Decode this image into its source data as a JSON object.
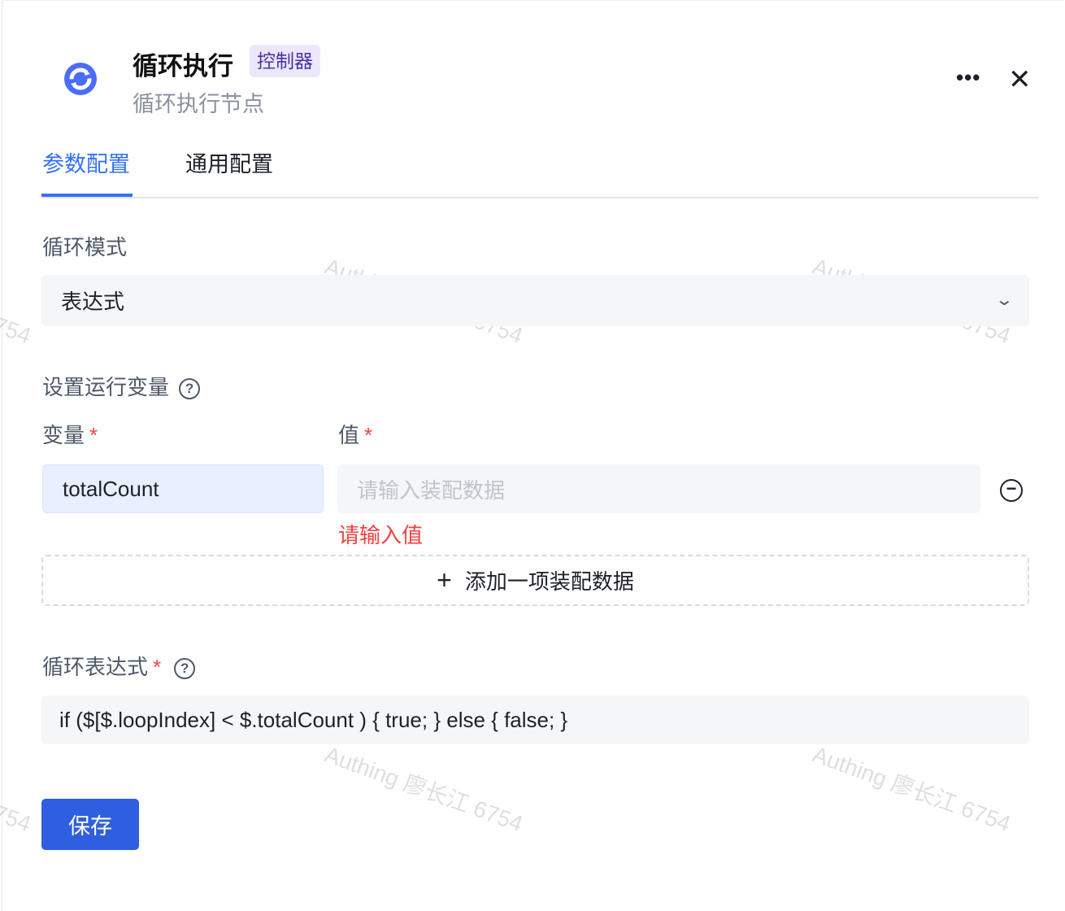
{
  "header": {
    "title": "循环执行",
    "tag": "控制器",
    "subtitle": "循环执行节点",
    "more_icon": "more-icon",
    "close_icon": "close-icon",
    "node_icon": "loop-icon"
  },
  "tabs": [
    {
      "label": "参数配置",
      "active": true
    },
    {
      "label": "通用配置",
      "active": false
    }
  ],
  "loop_mode": {
    "label": "循环模式",
    "value": "表达式"
  },
  "runtime_vars": {
    "label": "设置运行变量",
    "var_label": "变量",
    "value_label": "值",
    "required_mark": "*",
    "rows": [
      {
        "variable": "totalCount",
        "value_placeholder": "请输入装配数据",
        "error": "请输入值"
      }
    ],
    "add_label": "添加一项装配数据"
  },
  "loop_expression": {
    "label": "循环表达式",
    "required_mark": "*",
    "value": "if ($[$.loopIndex] < $.totalCount ) { true; } else { false; }"
  },
  "save_label": "保存",
  "watermark": "Authing 廖长江 6754",
  "colors": {
    "primary": "#3370ff",
    "save": "#2f5fe0",
    "error": "#f53f3f"
  }
}
